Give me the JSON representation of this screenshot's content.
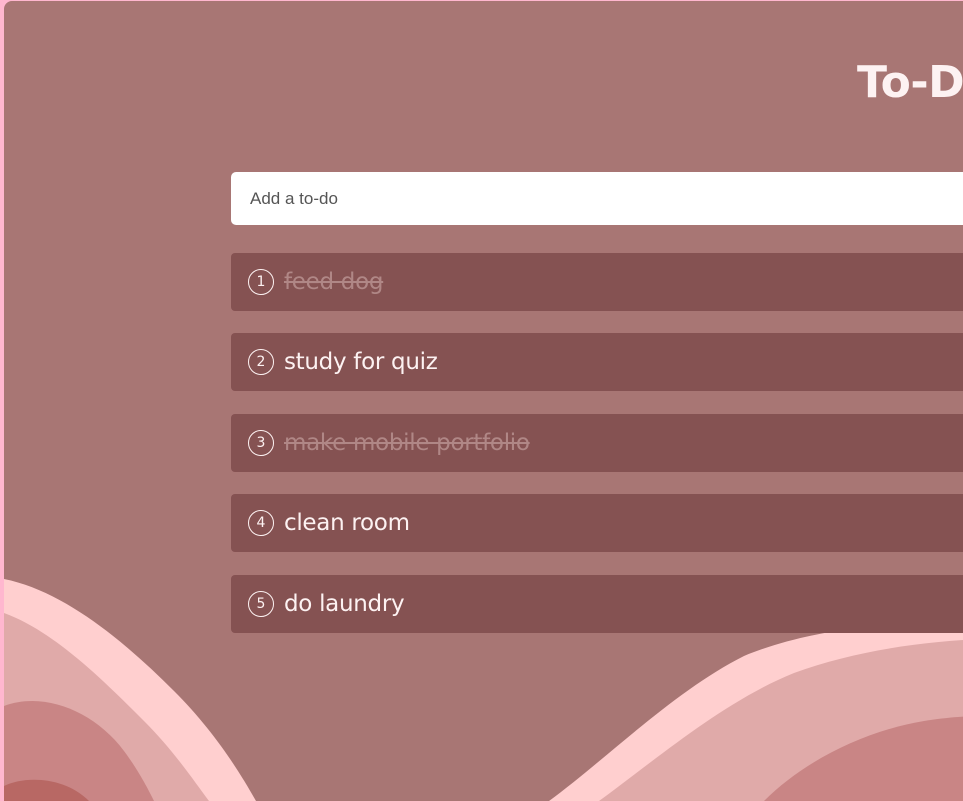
{
  "app": {
    "title": "To-Do"
  },
  "input": {
    "placeholder": "Add a to-do"
  },
  "todos": [
    {
      "number": "1",
      "text": "feed dog",
      "done": true
    },
    {
      "number": "2",
      "text": "study for quiz",
      "done": false
    },
    {
      "number": "3",
      "text": "make mobile portfolio",
      "done": true
    },
    {
      "number": "4",
      "text": "clean room",
      "done": false
    },
    {
      "number": "5",
      "text": "do laundry",
      "done": false
    }
  ],
  "colors": {
    "page_border": "#ffb7cf",
    "background": "#a87674",
    "item_background": "#855252",
    "text": "#fdf2f2",
    "done_text": "#b08786",
    "wave_light": "#ffcfcf",
    "wave_mid": "#e0aaa9",
    "wave_dark": "#c98585",
    "wave_darkest": "#b86864"
  }
}
